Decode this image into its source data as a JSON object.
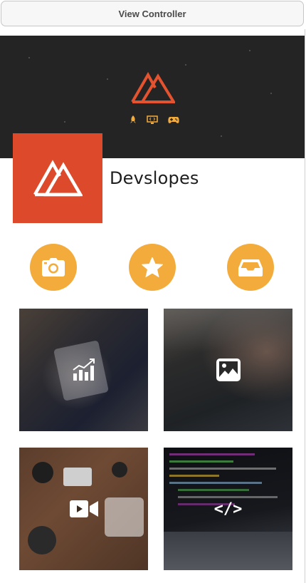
{
  "window": {
    "title": "View Controller"
  },
  "profile": {
    "name": "Devslopes"
  },
  "header": {
    "icons": [
      "rocket-icon",
      "monitor-code-icon",
      "gamepad-icon"
    ]
  },
  "actions": [
    {
      "name": "camera-button",
      "icon": "camera-icon"
    },
    {
      "name": "favorite-button",
      "icon": "star-icon"
    },
    {
      "name": "inbox-button",
      "icon": "inbox-tray-icon"
    }
  ],
  "tiles": [
    {
      "name": "tile-analytics",
      "icon": "bar-chart-icon"
    },
    {
      "name": "tile-photos",
      "icon": "image-icon"
    },
    {
      "name": "tile-video",
      "icon": "video-camera-icon"
    },
    {
      "name": "tile-code",
      "icon": "code-icon",
      "icon_text": "</>"
    }
  ],
  "colors": {
    "brand_orange": "#dd4a2b",
    "action_yellow": "#f3ab3c",
    "header_dark": "#242424"
  }
}
